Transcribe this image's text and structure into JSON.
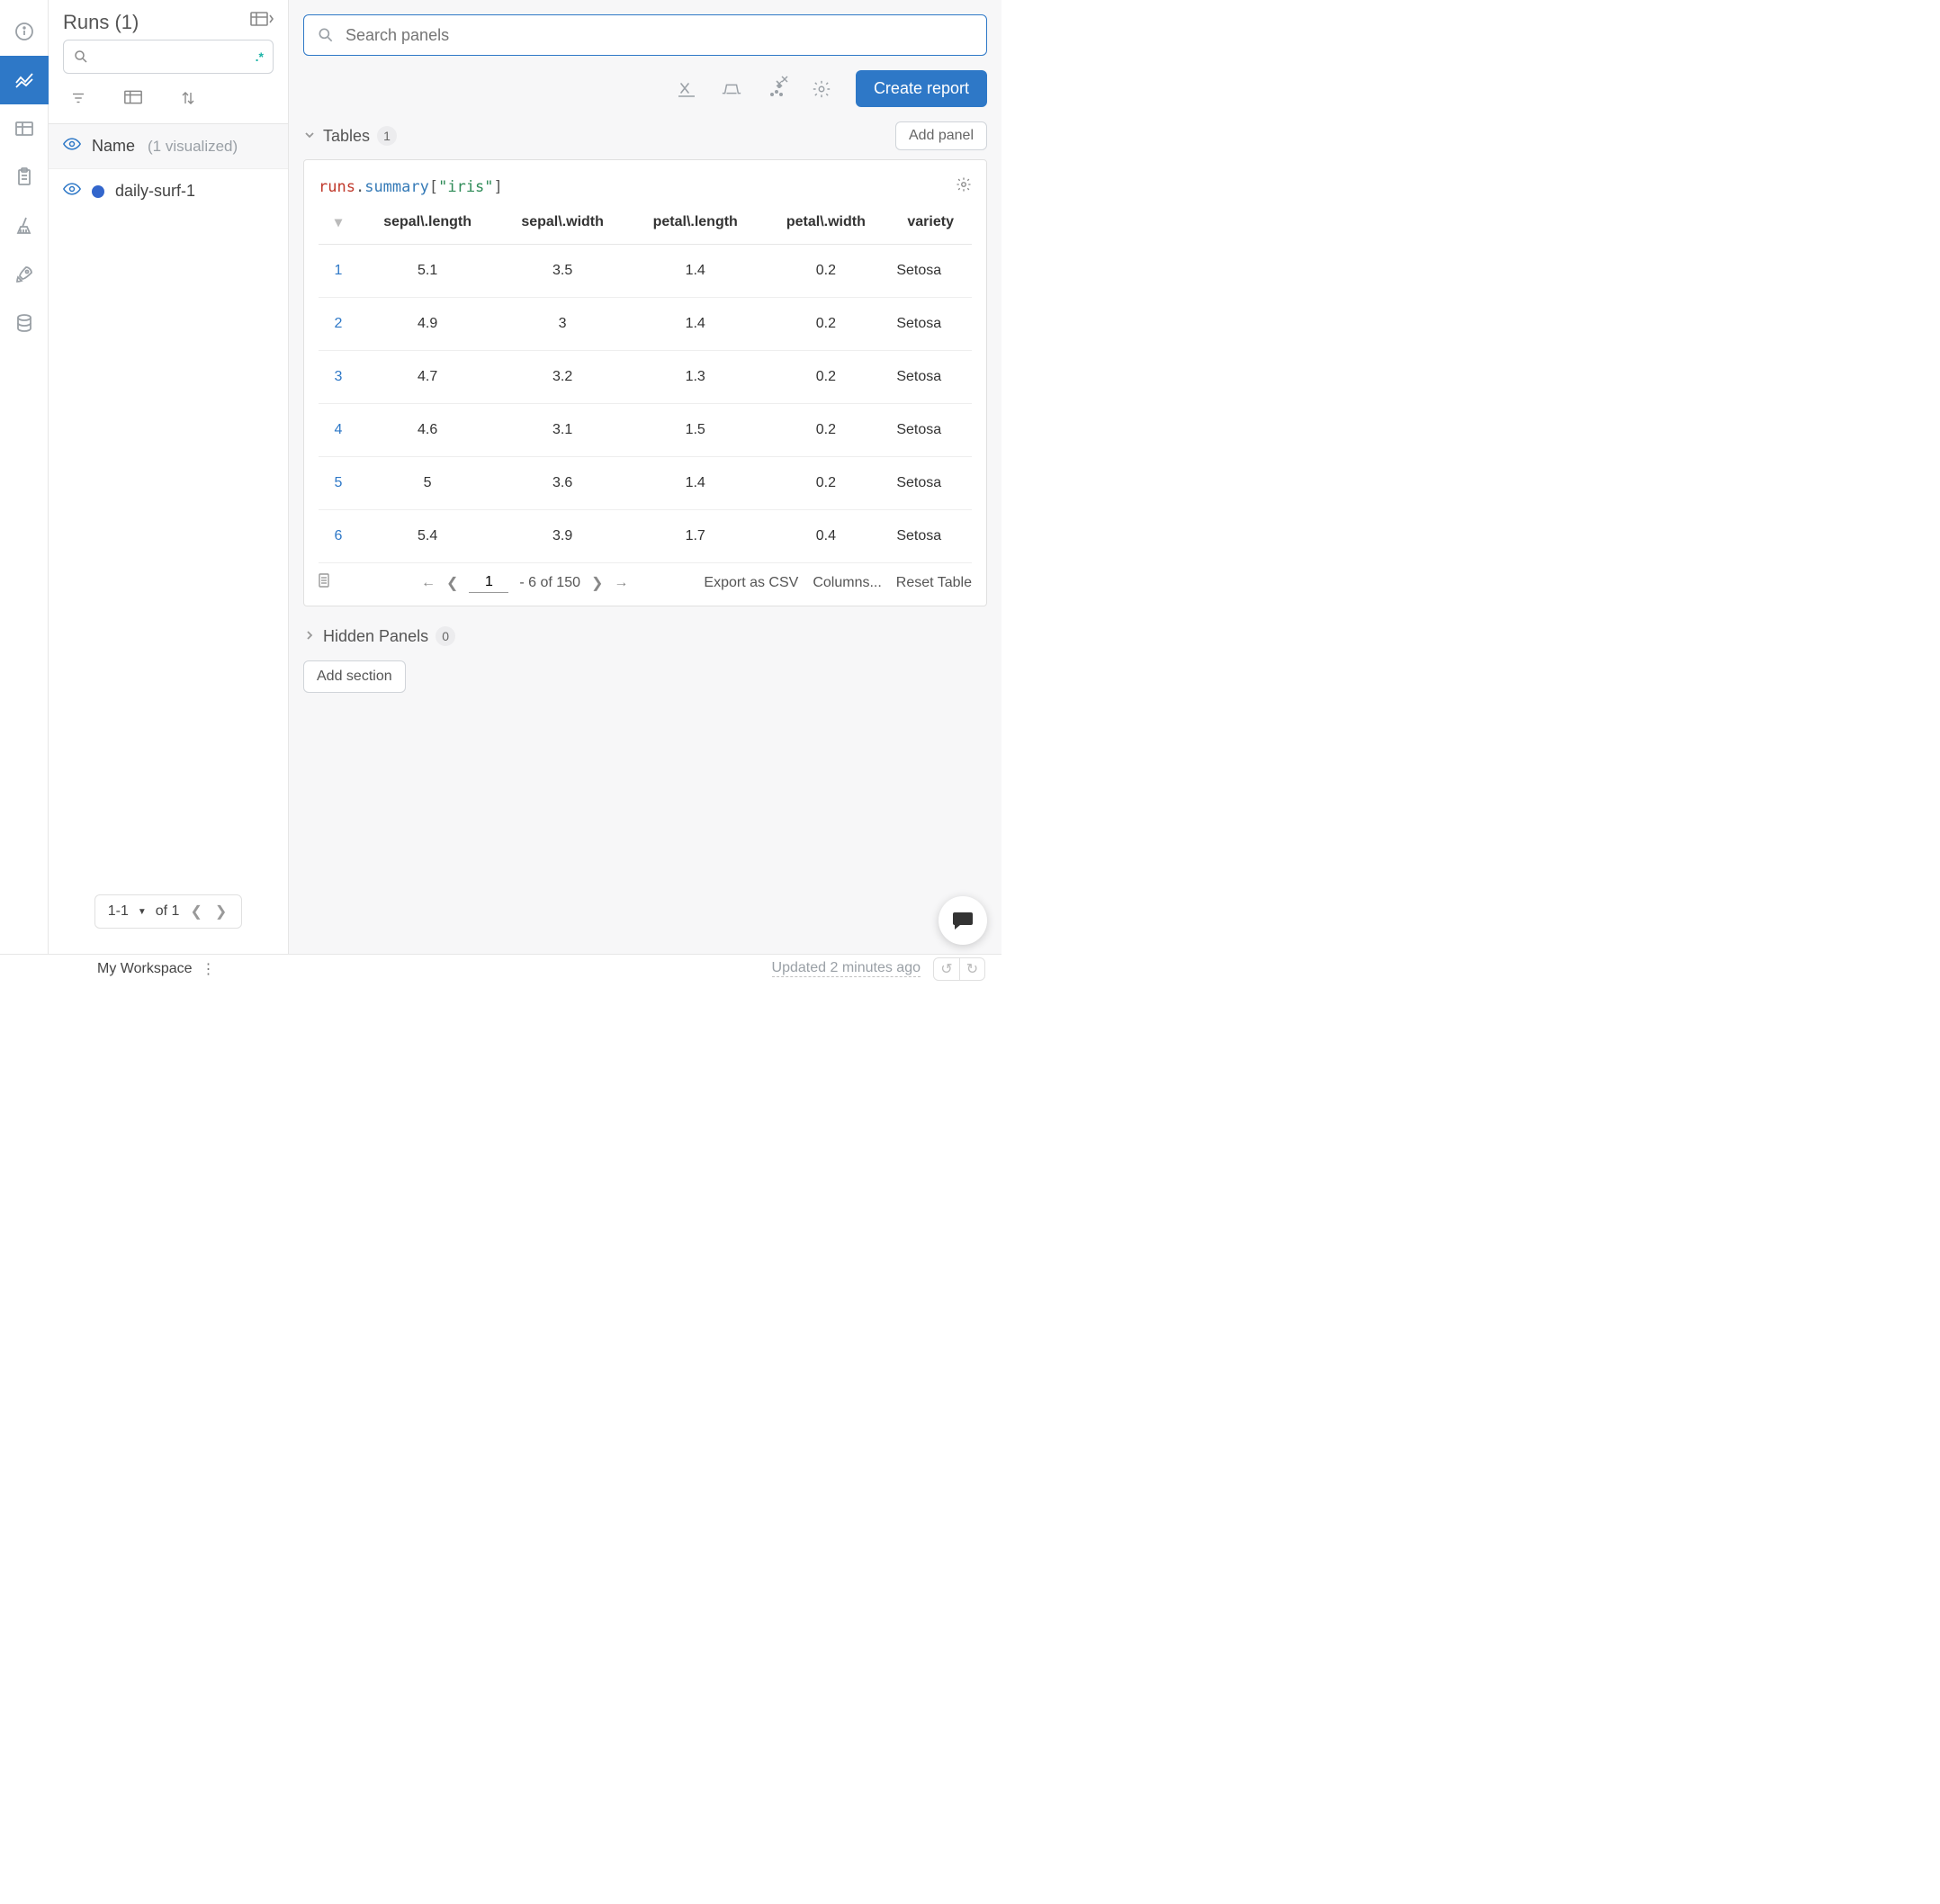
{
  "sidebar": {
    "title": "Runs (1)",
    "search_placeholder": "",
    "regex_hint": ".*",
    "name_group": {
      "label": "Name",
      "visualized": "(1 visualized)"
    },
    "runs": [
      {
        "name": "daily-surf-1",
        "color": "#3366cc"
      }
    ],
    "pager": {
      "range": "1-1",
      "of": "of 1"
    }
  },
  "main": {
    "search_placeholder": "Search panels",
    "create_report": "Create report",
    "add_panel": "Add panel",
    "add_section": "Add section",
    "sections": {
      "tables": {
        "title": "Tables",
        "count": "1"
      },
      "hidden": {
        "title": "Hidden Panels",
        "count": "0"
      }
    }
  },
  "table": {
    "code": {
      "obj": "runs",
      "attr": "summary",
      "key": "\"iris\""
    },
    "columns": [
      "sepal\\.length",
      "sepal\\.width",
      "petal\\.length",
      "petal\\.width",
      "variety"
    ],
    "rows": [
      {
        "idx": "1",
        "c0": "5.1",
        "c1": "3.5",
        "c2": "1.4",
        "c3": "0.2",
        "c4": "Setosa"
      },
      {
        "idx": "2",
        "c0": "4.9",
        "c1": "3",
        "c2": "1.4",
        "c3": "0.2",
        "c4": "Setosa"
      },
      {
        "idx": "3",
        "c0": "4.7",
        "c1": "3.2",
        "c2": "1.3",
        "c3": "0.2",
        "c4": "Setosa"
      },
      {
        "idx": "4",
        "c0": "4.6",
        "c1": "3.1",
        "c2": "1.5",
        "c3": "0.2",
        "c4": "Setosa"
      },
      {
        "idx": "5",
        "c0": "5",
        "c1": "3.6",
        "c2": "1.4",
        "c3": "0.2",
        "c4": "Setosa"
      },
      {
        "idx": "6",
        "c0": "5.4",
        "c1": "3.9",
        "c2": "1.7",
        "c3": "0.4",
        "c4": "Setosa"
      }
    ],
    "footer": {
      "page_input": "1",
      "page_text": "- 6 of 150",
      "export": "Export as CSV",
      "columns": "Columns...",
      "reset": "Reset Table"
    }
  },
  "footer": {
    "workspace": "My Workspace",
    "updated": "Updated 2 minutes ago"
  }
}
